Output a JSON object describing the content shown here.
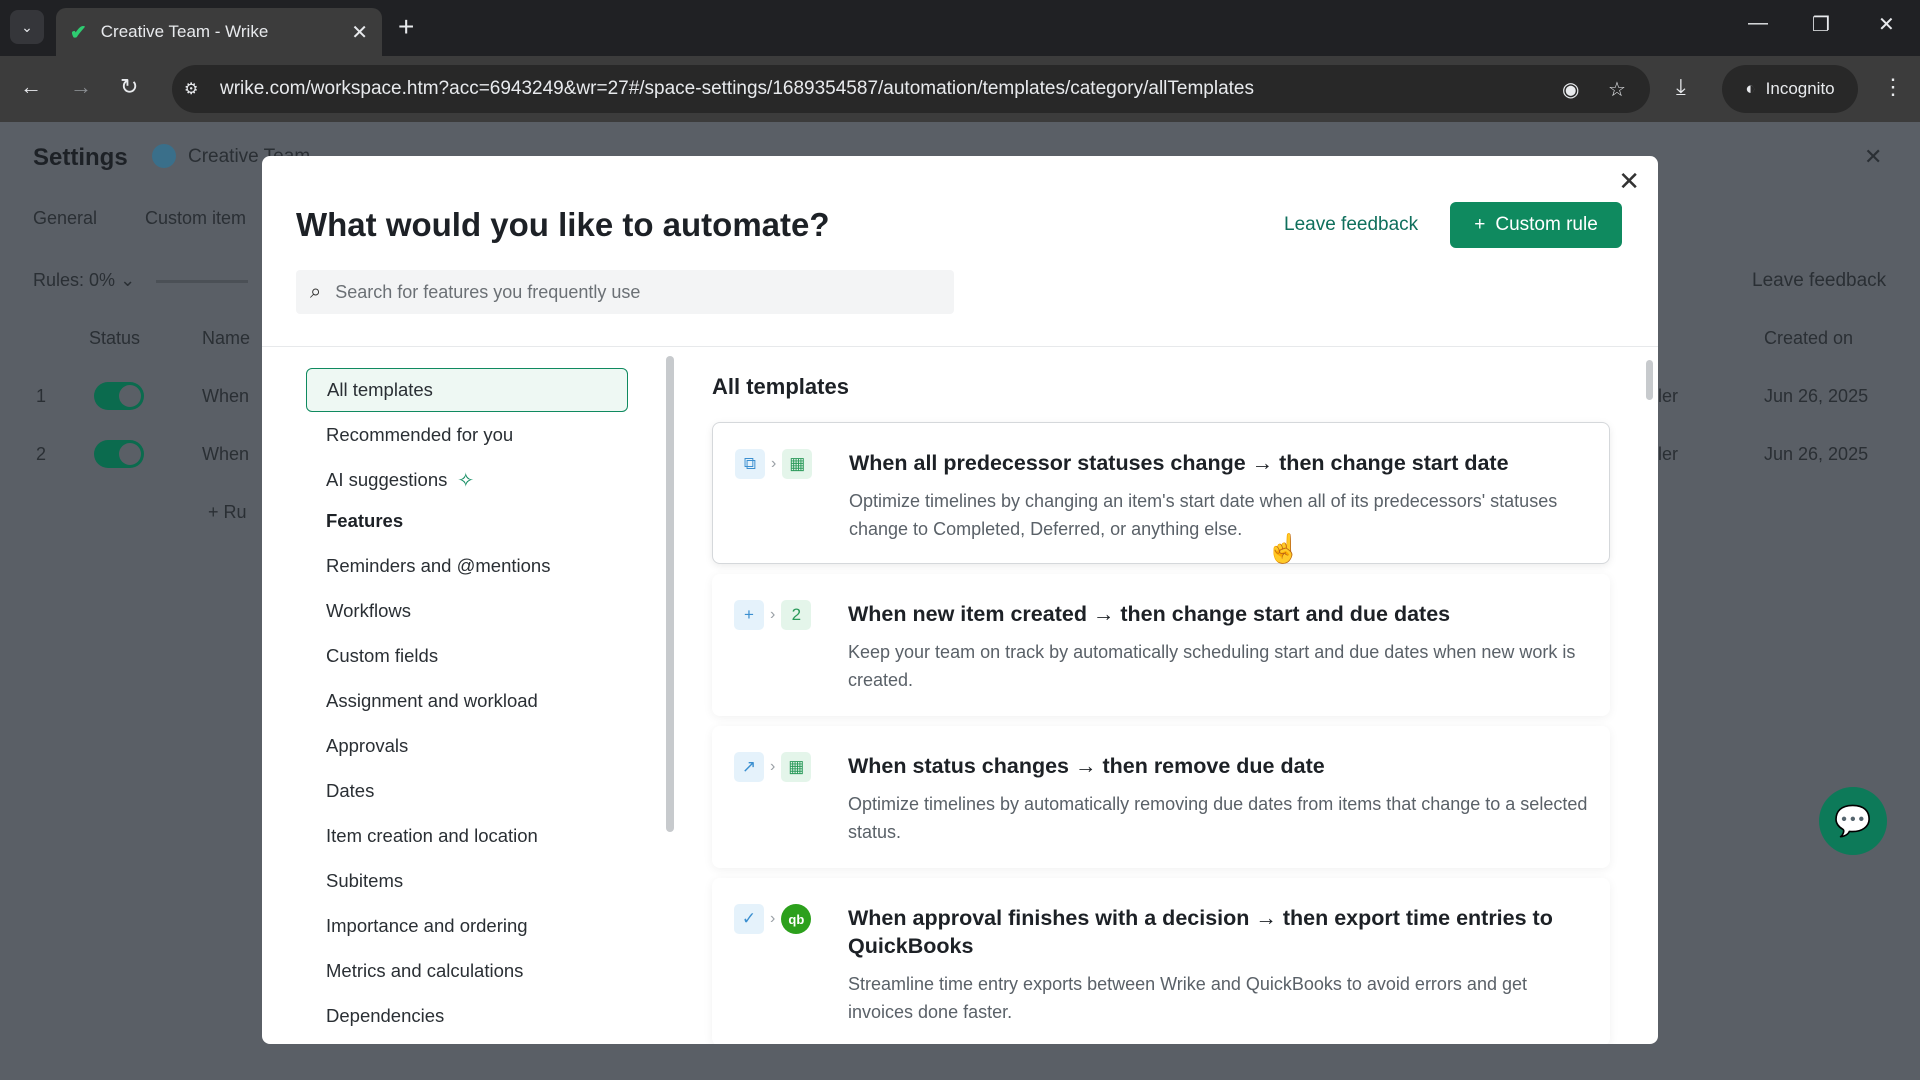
{
  "browser": {
    "tab_title": "Creative Team - Wrike",
    "url": "wrike.com/workspace.htm?acc=6943249&wr=27#/space-settings/1689354587/automation/templates/category/allTemplates",
    "incognito_label": "Incognito"
  },
  "app": {
    "title": "Settings",
    "space_name": "Creative Team",
    "tabs": [
      "General",
      "Custom item"
    ],
    "rules_label": "Rules: 0%",
    "leave_feedback": "Leave feedback",
    "columns": {
      "status": "Status",
      "name": "Name",
      "created_on": "Created on"
    },
    "rows": [
      {
        "num": "1",
        "name": "When",
        "owner": "ler",
        "created": "Jun 26, 2025"
      },
      {
        "num": "2",
        "name": "When",
        "owner": "ler",
        "created": "Jun 26, 2025"
      }
    ],
    "add_rule": "+ Ru"
  },
  "modal": {
    "title": "What would you like to automate?",
    "leave_feedback": "Leave feedback",
    "custom_rule": "Custom rule",
    "search_placeholder": "Search for features you frequently use",
    "sidebar": {
      "all_templates": "All templates",
      "recommended": "Recommended for you",
      "ai_suggestions": "AI suggestions",
      "features_heading": "Features",
      "features": [
        "Reminders and @mentions",
        "Workflows",
        "Custom fields",
        "Assignment and workload",
        "Approvals",
        "Dates",
        "Item creation and location",
        "Subitems",
        "Importance and ordering",
        "Metrics and calculations",
        "Dependencies"
      ]
    },
    "main_title": "All templates",
    "templates": [
      {
        "title": "When all predecessor statuses change → then change start date",
        "desc": "Optimize timelines by changing an item's start date when all of its predecessors' statuses change to Completed, Deferred, or anything else.",
        "icons": [
          "dependency-icon",
          "calendar-icon"
        ]
      },
      {
        "title": "When new item created → then change start and due dates",
        "desc": "Keep your team on track by automatically scheduling start and due dates when new work is created.",
        "icons": [
          "plus-icon",
          "date-number-icon"
        ],
        "date_number": "2"
      },
      {
        "title": "When status changes → then remove due date",
        "desc": "Optimize timelines by automatically removing due dates from items that change to a selected status.",
        "icons": [
          "status-change-icon",
          "calendar-icon"
        ]
      },
      {
        "title": "When approval finishes with a decision → then export time entries to QuickBooks",
        "desc": "Streamline time entry exports between Wrike and QuickBooks to avoid errors and get invoices done faster.",
        "icons": [
          "approval-check-icon",
          "quickbooks-icon"
        ]
      }
    ]
  }
}
